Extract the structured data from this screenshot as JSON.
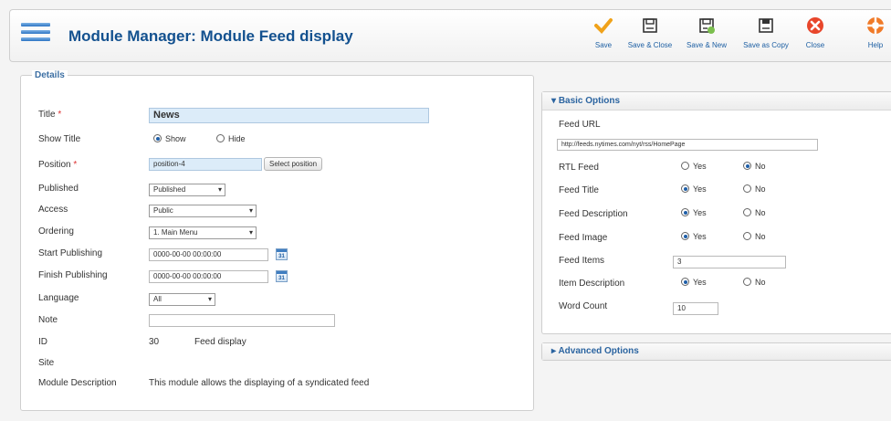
{
  "header": {
    "title": "Module Manager: Module Feed display",
    "toolbar": [
      {
        "label": "Save",
        "icon": "checkmark-icon"
      },
      {
        "label": "Save & Close",
        "icon": "save-close-icon"
      },
      {
        "label": "Save & New",
        "icon": "save-new-icon"
      },
      {
        "label": "Save as Copy",
        "icon": "save-copy-icon"
      },
      {
        "label": "Close",
        "icon": "close-icon"
      },
      {
        "label": "Help",
        "icon": "help-icon"
      }
    ]
  },
  "details": {
    "legend": "Details",
    "title": {
      "label": "Title",
      "required": "*",
      "value": "News"
    },
    "show_title": {
      "label": "Show Title",
      "options": [
        "Show",
        "Hide"
      ],
      "selected": "Show"
    },
    "position": {
      "label": "Position",
      "required": "*",
      "value": "position-4",
      "button": "Select position"
    },
    "published": {
      "label": "Published",
      "value": "Published"
    },
    "access": {
      "label": "Access",
      "value": "Public"
    },
    "ordering": {
      "label": "Ordering",
      "value": "1. Main Menu"
    },
    "start_publishing": {
      "label": "Start Publishing",
      "value": "0000-00-00 00:00:00"
    },
    "finish_publishing": {
      "label": "Finish Publishing",
      "value": "0000-00-00 00:00:00"
    },
    "language": {
      "label": "Language",
      "value": "All"
    },
    "note": {
      "label": "Note",
      "value": ""
    },
    "id": {
      "label": "ID",
      "value": "30",
      "type": "Feed display"
    },
    "site": {
      "label": "Site"
    },
    "module_description": {
      "label": "Module Description",
      "value": "This module allows the displaying of a syndicated feed"
    },
    "calendar_glyph": "31"
  },
  "basic_options": {
    "heading": "Basic Options",
    "arrow": "▾",
    "feed_url": {
      "label": "Feed URL",
      "value": "http://feeds.nytimes.com/nyt/rss/HomePage"
    },
    "yes": "Yes",
    "no": "No",
    "rtl_feed": {
      "label": "RTL Feed",
      "selected": "No"
    },
    "feed_title": {
      "label": "Feed Title",
      "selected": "Yes"
    },
    "feed_description": {
      "label": "Feed Description",
      "selected": "Yes"
    },
    "feed_image": {
      "label": "Feed Image",
      "selected": "Yes"
    },
    "feed_items": {
      "label": "Feed Items",
      "value": "3"
    },
    "item_description": {
      "label": "Item Description",
      "selected": "Yes"
    },
    "word_count": {
      "label": "Word Count",
      "value": "10"
    }
  },
  "advanced_options": {
    "heading": "Advanced Options",
    "arrow": "▸"
  },
  "colors": {
    "accent": "#1d5fa3",
    "title": "#13518f",
    "required": "#d33333",
    "close": "#e8462b",
    "save": "#f0a21a"
  }
}
